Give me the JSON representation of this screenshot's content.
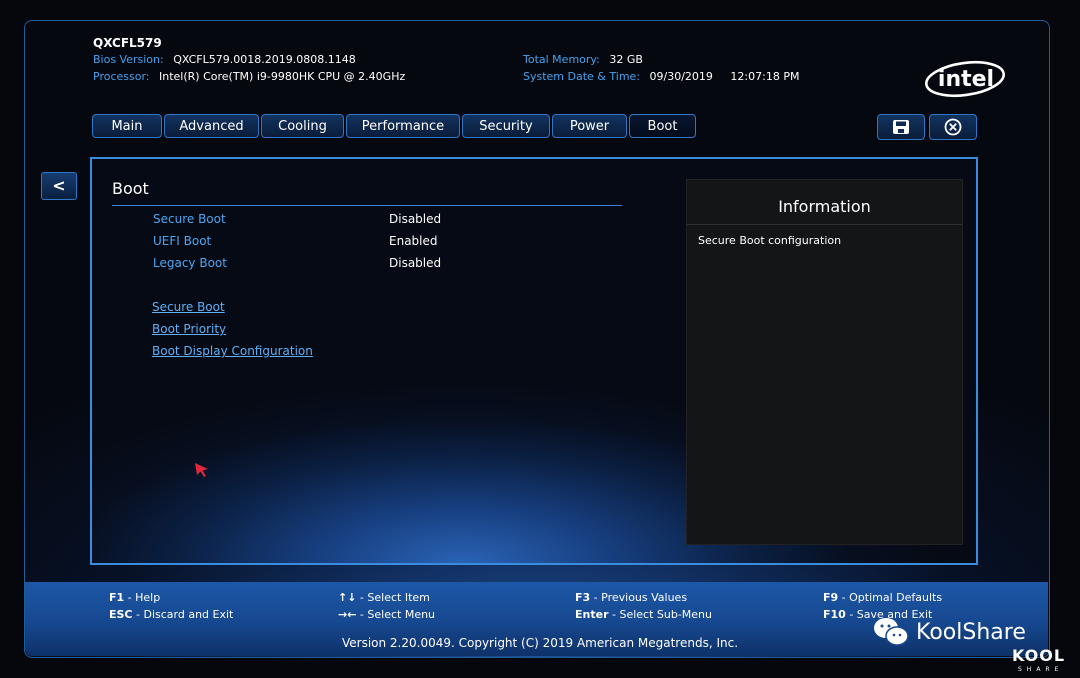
{
  "header": {
    "model": "QXCFL579",
    "bios_version_label": "Bios Version:",
    "bios_version": "QXCFL579.0018.2019.0808.1148",
    "processor_label": "Processor:",
    "processor": "Intel(R) Core(TM) i9-9980HK CPU @ 2.40GHz",
    "total_memory_label": "Total Memory:",
    "total_memory": "32 GB",
    "datetime_label": "System Date & Time:",
    "date": "09/30/2019",
    "time": "12:07:18 PM",
    "logo": "intel"
  },
  "tabs": [
    {
      "label": "Main"
    },
    {
      "label": "Advanced"
    },
    {
      "label": "Cooling"
    },
    {
      "label": "Performance"
    },
    {
      "label": "Security"
    },
    {
      "label": "Power"
    },
    {
      "label": "Boot"
    }
  ],
  "active_tab": "Boot",
  "toolbar": {
    "save_icon": "floppy-save-icon",
    "exit_icon": "circle-x-close-icon"
  },
  "back_button": "<",
  "panel": {
    "title": "Boot",
    "options": [
      {
        "label": "Secure Boot",
        "value": "Disabled"
      },
      {
        "label": "UEFI Boot",
        "value": "Enabled"
      },
      {
        "label": "Legacy Boot",
        "value": "Disabled"
      }
    ],
    "submenus": [
      "Secure Boot",
      "Boot Priority",
      "Boot Display Configuration"
    ]
  },
  "information": {
    "title": "Information",
    "text": "Secure Boot configuration"
  },
  "footer": {
    "keys": [
      {
        "key": "F1",
        "desc": " - Help"
      },
      {
        "key": "ESC",
        "desc": " - Discard and Exit"
      },
      {
        "key": "↑↓",
        "desc": " - Select Item"
      },
      {
        "key": "→←",
        "desc": " - Select Menu"
      },
      {
        "key": "F3",
        "desc": " - Previous Values"
      },
      {
        "key": "Enter",
        "desc": " - Select Sub-Menu"
      },
      {
        "key": "F9",
        "desc": " - Optimal Defaults"
      },
      {
        "key": "F10",
        "desc": " - Save and Exit"
      }
    ],
    "copyright": "Version 2.20.0049. Copyright (C) 2019 American Megatrends, Inc."
  },
  "watermark": {
    "brand": "KoolShare",
    "logo_text": "KOOL",
    "sub": "SHARE"
  },
  "colors": {
    "label_blue": "#46a2f0",
    "accent_border": "#3a8cdf",
    "footer_blue": "#1d57a8"
  }
}
